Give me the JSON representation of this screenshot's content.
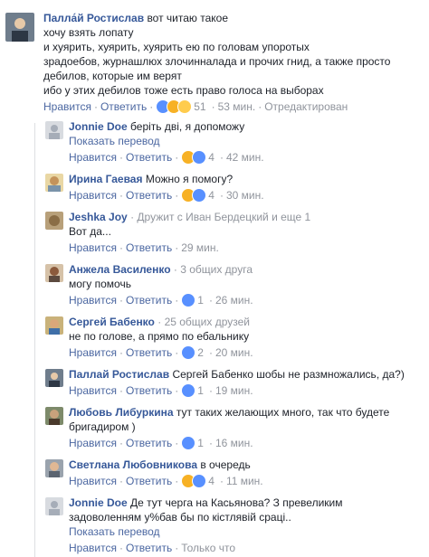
{
  "comments": [
    {
      "author": "Палла́й Ростислав",
      "text": "вот читаю такое",
      "lines": [
        "хочу взять лопату",
        "и хуярить, хуярить, хуярить ею по головам упоротых",
        "зрадоебов, журнашлюх злочинналада и прочих гнид, а также просто",
        "дебилов, которые им верят",
        "ибо у этих дебилов тоже есть право голоса на выборах"
      ],
      "actions": {
        "like": "Нравится",
        "reply": "Ответить",
        "reactions": "51",
        "time": "53 мин.",
        "edited": "Отредактирован"
      }
    },
    {
      "author": "Jonnie Doe",
      "text": "беріть дві, я допоможу",
      "translate": "Показать перевод",
      "actions": {
        "like": "Нравится",
        "reply": "Ответить",
        "reactions": "4",
        "time": "42 мин."
      }
    },
    {
      "author": "Ирина Гаевая",
      "text": "Можно я помогу?",
      "actions": {
        "like": "Нравится",
        "reply": "Ответить",
        "reactions": "4",
        "time": "30 мин."
      }
    },
    {
      "author": "Jeshka Joy",
      "meta": "Дружит с Иван Бердецкий и еще 1",
      "lines": [
        "Вот да..."
      ],
      "actions": {
        "like": "Нравится",
        "reply": "Ответить",
        "time": "29 мин."
      }
    },
    {
      "author": "Анжела Василенко",
      "meta": "3 общих друга",
      "lines": [
        "могу помочь"
      ],
      "actions": {
        "like": "Нравится",
        "reply": "Ответить",
        "reactions": "1",
        "time": "26 мин."
      }
    },
    {
      "author": "Сергей Бабенко",
      "meta": "25 общих друзей",
      "lines": [
        "не по голове, а прямо по ебальнику"
      ],
      "actions": {
        "like": "Нравится",
        "reply": "Ответить",
        "reactions": "2",
        "time": "20 мин."
      }
    },
    {
      "author": "Паллай Ростислав",
      "text": "Сергей Бабенко шобы не размножались, да?)",
      "actions": {
        "like": "Нравится",
        "reply": "Ответить",
        "reactions": "1",
        "time": "19 мин."
      }
    },
    {
      "author": "Любовь Либуркина",
      "text": "тут таких желающих много, так что будете",
      "lines": [
        "бригадиром )"
      ],
      "actions": {
        "like": "Нравится",
        "reply": "Ответить",
        "reactions": "1",
        "time": "16 мин."
      }
    },
    {
      "author": "Светлана Любовникова",
      "text": "в очередь",
      "actions": {
        "like": "Нравится",
        "reply": "Ответить",
        "reactions": "4",
        "time": "11 мин."
      }
    },
    {
      "author": "Jonnie Doe",
      "text": "Де тут черга на Касьянова? З превеликим",
      "lines": [
        "задоволенням у%бав бы по кістлявій сраці.."
      ],
      "translate": "Показать перевод",
      "actions": {
        "like": "Нравится",
        "reply": "Ответить",
        "time": "Только что"
      }
    }
  ],
  "dot": "·",
  "colors": {
    "link": "#365899",
    "meta": "#90949c",
    "like": "#5890ff",
    "haha": "#f7b125"
  }
}
